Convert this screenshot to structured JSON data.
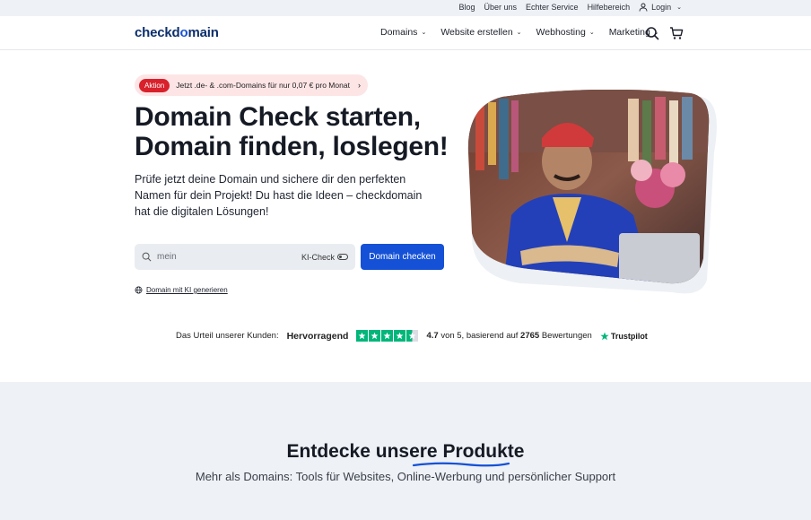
{
  "topbar": {
    "links": [
      "Blog",
      "Über uns",
      "Echter Service",
      "Hilfebereich"
    ],
    "login_label": "Login"
  },
  "header": {
    "logo": {
      "part1": "checkd",
      "part2": "o",
      "part3": "main"
    },
    "nav": [
      "Domains",
      "Website erstellen",
      "Webhosting",
      "Marketing"
    ],
    "icons": [
      "search-icon",
      "cart-icon"
    ]
  },
  "hero": {
    "promo_badge": "Aktion",
    "promo_text": "Jetzt .de- & .com-Domains für nur 0,07 € pro Monat",
    "title_line1": "Domain Check starten,",
    "title_line2": "Domain finden, loslegen!",
    "lead": "Prüfe jetzt deine Domain und sichere dir den perfekten Namen für dein Projekt! Du hast die Ideen – checkdomain hat die digitalen Lösungen!",
    "search_placeholder": "mein",
    "ki_check_label": "KI-Check",
    "cta_label": "Domain checken",
    "ki_link": "Domain mit KI generieren"
  },
  "rating": {
    "label": "Das Urteil unserer Kunden:",
    "word": "Hervorragend",
    "score": "4.7",
    "score_suffix": "von 5, basierend auf",
    "count": "2765",
    "count_suffix": "Bewertungen",
    "provider": "Trustpilot",
    "stars_value": 4.5,
    "color": "#00b67a"
  },
  "products": {
    "title_part1": "Entdecke",
    "title_part2": "unsere Produkte",
    "subtitle": "Mehr als Domains: Tools für Websites, Online-Werbung und persönlicher Support"
  },
  "colors": {
    "primary": "#1551d6",
    "promo_bg": "#fde5e6",
    "promo_badge": "#d8212b",
    "section_bg": "#eef1f5"
  }
}
